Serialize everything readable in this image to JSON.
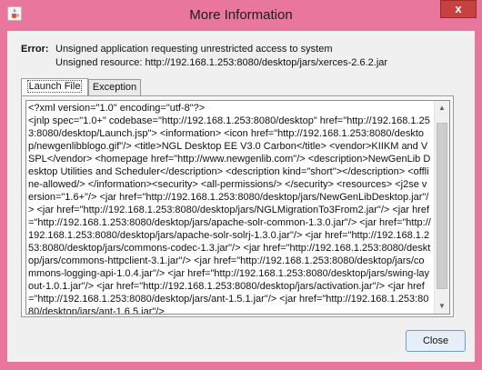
{
  "window": {
    "title": "More Information",
    "close_glyph": "x",
    "app_icon": "java-cup-icon"
  },
  "error": {
    "label": "Error:",
    "message": "Unsigned application requesting unrestricted access to system",
    "resource": "Unsigned resource: http://192.168.1.253:8080/desktop/jars/xerces-2.6.2.jar"
  },
  "tabs": [
    {
      "label": "Launch File",
      "active": true
    },
    {
      "label": "Exception",
      "active": false
    }
  ],
  "launch_file_content": "<?xml version=\"1.0\" encoding=\"utf-8\"?>\n<jnlp spec=\"1.0+\" codebase=\"http://192.168.1.253:8080/desktop\" href=\"http://192.168.1.253:8080/desktop/Launch.jsp\"> <information> <icon href=\"http://192.168.1.253:8080/desktop/newgenlibblogo.gif\"/> <title>NGL Desktop EE V3.0 Carbon</title> <vendor>KIIKM and VSPL</vendor> <homepage href=\"http://www.newgenlib.com\"/> <description>NewGenLib Desktop Utilities and Scheduler</description> <description kind=\"short\"></description> <offline-allowed/> </information><security> <all-permissions/> </security> <resources> <j2se version=\"1.6+\"/> <jar href=\"http://192.168.1.253:8080/desktop/jars/NewGenLibDesktop.jar\"/> <jar href=\"http://192.168.1.253:8080/desktop/jars/NGLMigrationTo3From2.jar\"/> <jar href=\"http://192.168.1.253:8080/desktop/jars/apache-solr-common-1.3.0.jar\"/> <jar href=\"http://192.168.1.253:8080/desktop/jars/apache-solr-solrj-1.3.0.jar\"/> <jar href=\"http://192.168.1.253:8080/desktop/jars/commons-codec-1.3.jar\"/> <jar href=\"http://192.168.1.253:8080/desktop/jars/commons-httpclient-3.1.jar\"/> <jar href=\"http://192.168.1.253:8080/desktop/jars/commons-logging-api-1.0.4.jar\"/> <jar href=\"http://192.168.1.253:8080/desktop/jars/swing-layout-1.0.1.jar\"/> <jar href=\"http://192.168.1.253:8080/desktop/jars/activation.jar\"/> <jar href=\"http://192.168.1.253:8080/desktop/jars/ant-1.5.1.jar\"/> <jar href=\"http://192.168.1.253:8080/desktop/jars/ant-1.6.5.jar\"/>",
  "scrollbar": {
    "up_glyph": "▲",
    "down_glyph": "▼"
  },
  "buttons": {
    "close_label": "Close"
  }
}
